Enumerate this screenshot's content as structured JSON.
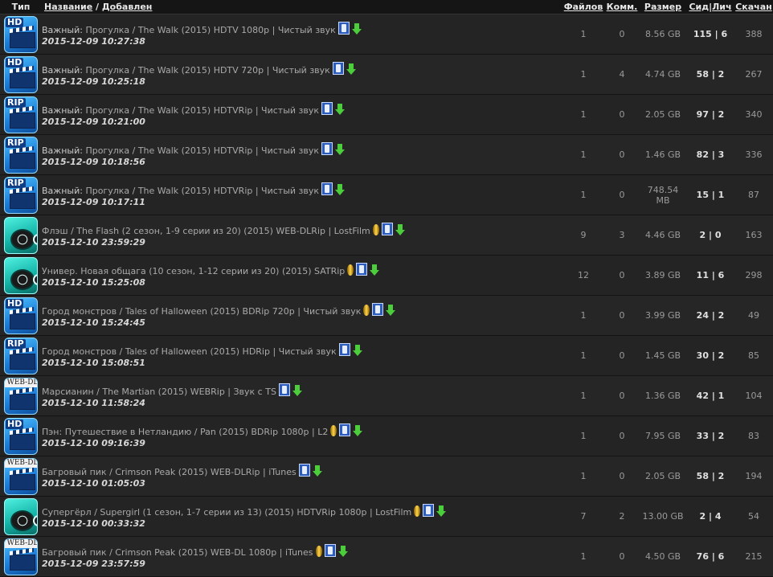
{
  "header": {
    "type": "Тип",
    "name": "Название",
    "sep": " / ",
    "added": "Добавлен",
    "files": "Файлов",
    "comments": "Комм.",
    "size": "Размер",
    "seed": "Сид",
    "leech": "Лич",
    "downloaded": "Скачан"
  },
  "rows": [
    {
      "badge": "HD",
      "prefix": "Важный:",
      "title": "Прогулка / The Walk (2015) HDTV 1080p | Чистый звук",
      "date": "2015-12-09 10:27:38",
      "files": "1",
      "comments": "0",
      "size": "8.56 GB",
      "seed": "115",
      "leech": "6",
      "downloaded": "388",
      "gold": false
    },
    {
      "badge": "HD",
      "prefix": "Важный:",
      "title": "Прогулка / The Walk (2015) HDTV 720p | Чистый звук",
      "date": "2015-12-09 10:25:18",
      "files": "1",
      "comments": "4",
      "size": "4.74 GB",
      "seed": "58",
      "leech": "2",
      "downloaded": "267",
      "gold": false
    },
    {
      "badge": "RIP",
      "prefix": "Важный:",
      "title": "Прогулка / The Walk (2015) HDTVRip | Чистый звук",
      "date": "2015-12-09 10:21:00",
      "files": "1",
      "comments": "0",
      "size": "2.05 GB",
      "seed": "97",
      "leech": "2",
      "downloaded": "340",
      "gold": false
    },
    {
      "badge": "RIP",
      "prefix": "Важный:",
      "title": "Прогулка / The Walk (2015) HDTVRip | Чистый звук",
      "date": "2015-12-09 10:18:56",
      "files": "1",
      "comments": "0",
      "size": "1.46 GB",
      "seed": "82",
      "leech": "3",
      "downloaded": "336",
      "gold": false
    },
    {
      "badge": "RIP",
      "prefix": "Важный:",
      "title": "Прогулка / The Walk (2015) HDTVRip | Чистый звук",
      "date": "2015-12-09 10:17:11",
      "files": "1",
      "comments": "0",
      "size": "748.54 MB",
      "seed": "15",
      "leech": "1",
      "downloaded": "87",
      "gold": false
    },
    {
      "badge": "SERIAL",
      "prefix": "",
      "title": "Флэш / The Flash (2 сезон, 1-9 серии из 20) (2015) WEB-DLRip | LostFilm",
      "date": "2015-12-10 23:59:29",
      "files": "9",
      "comments": "3",
      "size": "4.46 GB",
      "seed": "2",
      "leech": "0",
      "downloaded": "163",
      "gold": true
    },
    {
      "badge": "SERIAL",
      "prefix": "",
      "title": "Универ. Новая общага (10 сезон, 1-12 серии из 20) (2015) SATRip",
      "date": "2015-12-10 15:25:08",
      "files": "12",
      "comments": "0",
      "size": "3.89 GB",
      "seed": "11",
      "leech": "6",
      "downloaded": "298",
      "gold": true
    },
    {
      "badge": "HD",
      "prefix": "",
      "title": "Город монстров / Tales of Halloween (2015) BDRip 720p | Чистый звук",
      "date": "2015-12-10 15:24:45",
      "files": "1",
      "comments": "0",
      "size": "3.99 GB",
      "seed": "24",
      "leech": "2",
      "downloaded": "49",
      "gold": true
    },
    {
      "badge": "RIP",
      "prefix": "",
      "title": "Город монстров / Tales of Halloween (2015) HDRip | Чистый звук",
      "date": "2015-12-10 15:08:51",
      "files": "1",
      "comments": "0",
      "size": "1.45 GB",
      "seed": "30",
      "leech": "2",
      "downloaded": "85",
      "gold": false
    },
    {
      "badge": "WEB-DL",
      "prefix": "",
      "title": "Марсианин / The Martian (2015) WEBRip | Звук с TS",
      "date": "2015-12-10 11:58:24",
      "files": "1",
      "comments": "0",
      "size": "1.36 GB",
      "seed": "42",
      "leech": "1",
      "downloaded": "104",
      "gold": false
    },
    {
      "badge": "HD",
      "prefix": "",
      "title": "Пэн: Путешествие в Нетландию / Pan (2015) BDRip 1080p | L2",
      "date": "2015-12-10 09:16:39",
      "files": "1",
      "comments": "0",
      "size": "7.95 GB",
      "seed": "33",
      "leech": "2",
      "downloaded": "83",
      "gold": true
    },
    {
      "badge": "WEB-DL",
      "prefix": "",
      "title": "Багровый пик / Crimson Peak (2015) WEB-DLRip | iTunes",
      "date": "2015-12-10 01:05:03",
      "files": "1",
      "comments": "0",
      "size": "2.05 GB",
      "seed": "58",
      "leech": "2",
      "downloaded": "194",
      "gold": false
    },
    {
      "badge": "SERIAL",
      "prefix": "",
      "title": "Супергёрл / Supergirl (1 сезон, 1-7 серии из 13) (2015) HDTVRip 1080p | LostFilm",
      "date": "2015-12-10 00:33:32",
      "files": "7",
      "comments": "2",
      "size": "13.00 GB",
      "seed": "2",
      "leech": "4",
      "downloaded": "54",
      "gold": true
    },
    {
      "badge": "WEB-DL",
      "prefix": "",
      "title": "Багровый пик / Crimson Peak (2015) WEB-DL 1080p | iTunes",
      "date": "2015-12-09 23:57:59",
      "files": "1",
      "comments": "0",
      "size": "4.50 GB",
      "seed": "76",
      "leech": "6",
      "downloaded": "215",
      "gold": true
    }
  ]
}
